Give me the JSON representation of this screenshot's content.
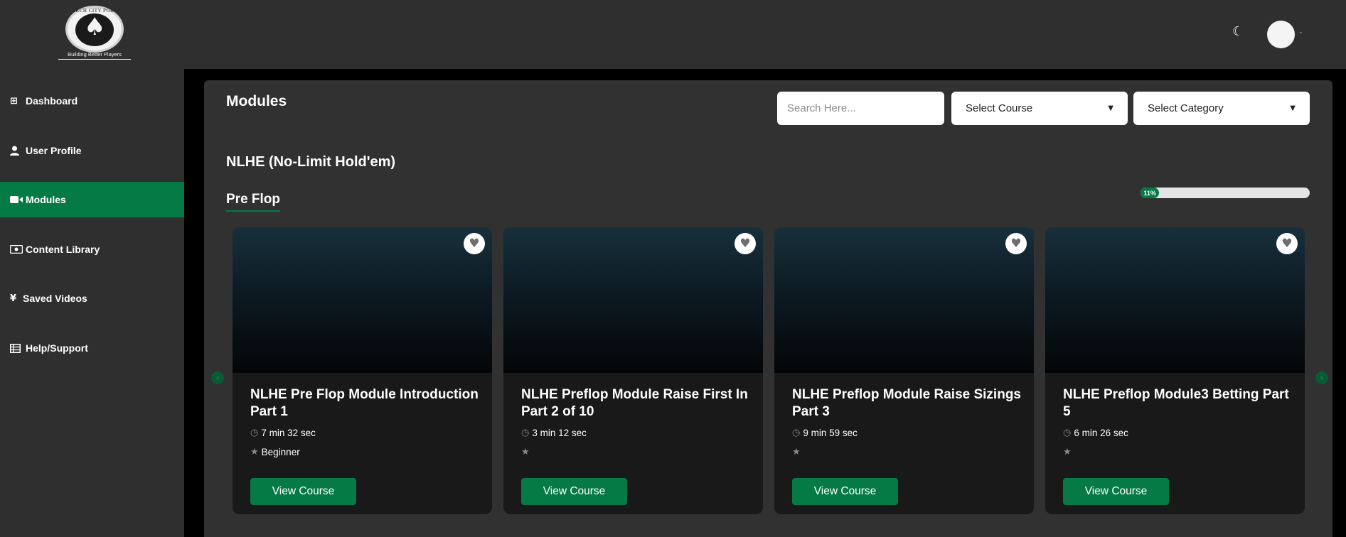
{
  "brand": {
    "name": "ARCH CITY POKER",
    "tagline": "Building Better Players"
  },
  "header": {
    "theme_toggle_icon": "moon-icon",
    "avatar_caret": "⌄"
  },
  "sidebar": {
    "items": [
      {
        "label": "Dashboard",
        "icon": "grid-icon",
        "glyph": "⊞",
        "active": false
      },
      {
        "label": "User Profile",
        "icon": "user-icon",
        "glyph": "👤",
        "active": false
      },
      {
        "label": "Modules",
        "icon": "video-icon",
        "glyph": "■◀",
        "active": true
      },
      {
        "label": "Content Library",
        "icon": "money-icon",
        "glyph": "▣",
        "active": false
      },
      {
        "label": "Saved Videos",
        "icon": "yen-icon",
        "glyph": "¥",
        "active": false
      },
      {
        "label": "Help/Support",
        "icon": "table-icon",
        "glyph": "▤",
        "active": false
      }
    ]
  },
  "main": {
    "title": "Modules",
    "search_placeholder": "Search Here...",
    "course_select": "Select Course",
    "category_select": "Select Category",
    "section_title": "NLHE (No-Limit Hold'em)",
    "sub_title": "Pre Flop",
    "progress": {
      "percent": 11,
      "label": "11%"
    },
    "prev_arrow": "‹",
    "next_arrow": "›",
    "cards": [
      {
        "title": "NLHE Pre Flop Module Introduction Part 1",
        "duration": "7 min 32 sec",
        "level": "Beginner",
        "button": "View Course"
      },
      {
        "title": "NLHE Preflop Module Raise First In Part 2 of 10",
        "duration": "3 min 12 sec",
        "level": "",
        "button": "View Course"
      },
      {
        "title": "NLHE Preflop Module Raise Sizings Part 3",
        "duration": "9 min 59 sec",
        "level": "",
        "button": "View Course"
      },
      {
        "title": "NLHE Preflop Module3 Betting Part 5",
        "duration": "6 min 26 sec",
        "level": "",
        "button": "View Course"
      }
    ]
  },
  "colors": {
    "accent": "#057a45",
    "topbar": "#2f2f2f",
    "panel": "#313131",
    "card": "#191919"
  }
}
